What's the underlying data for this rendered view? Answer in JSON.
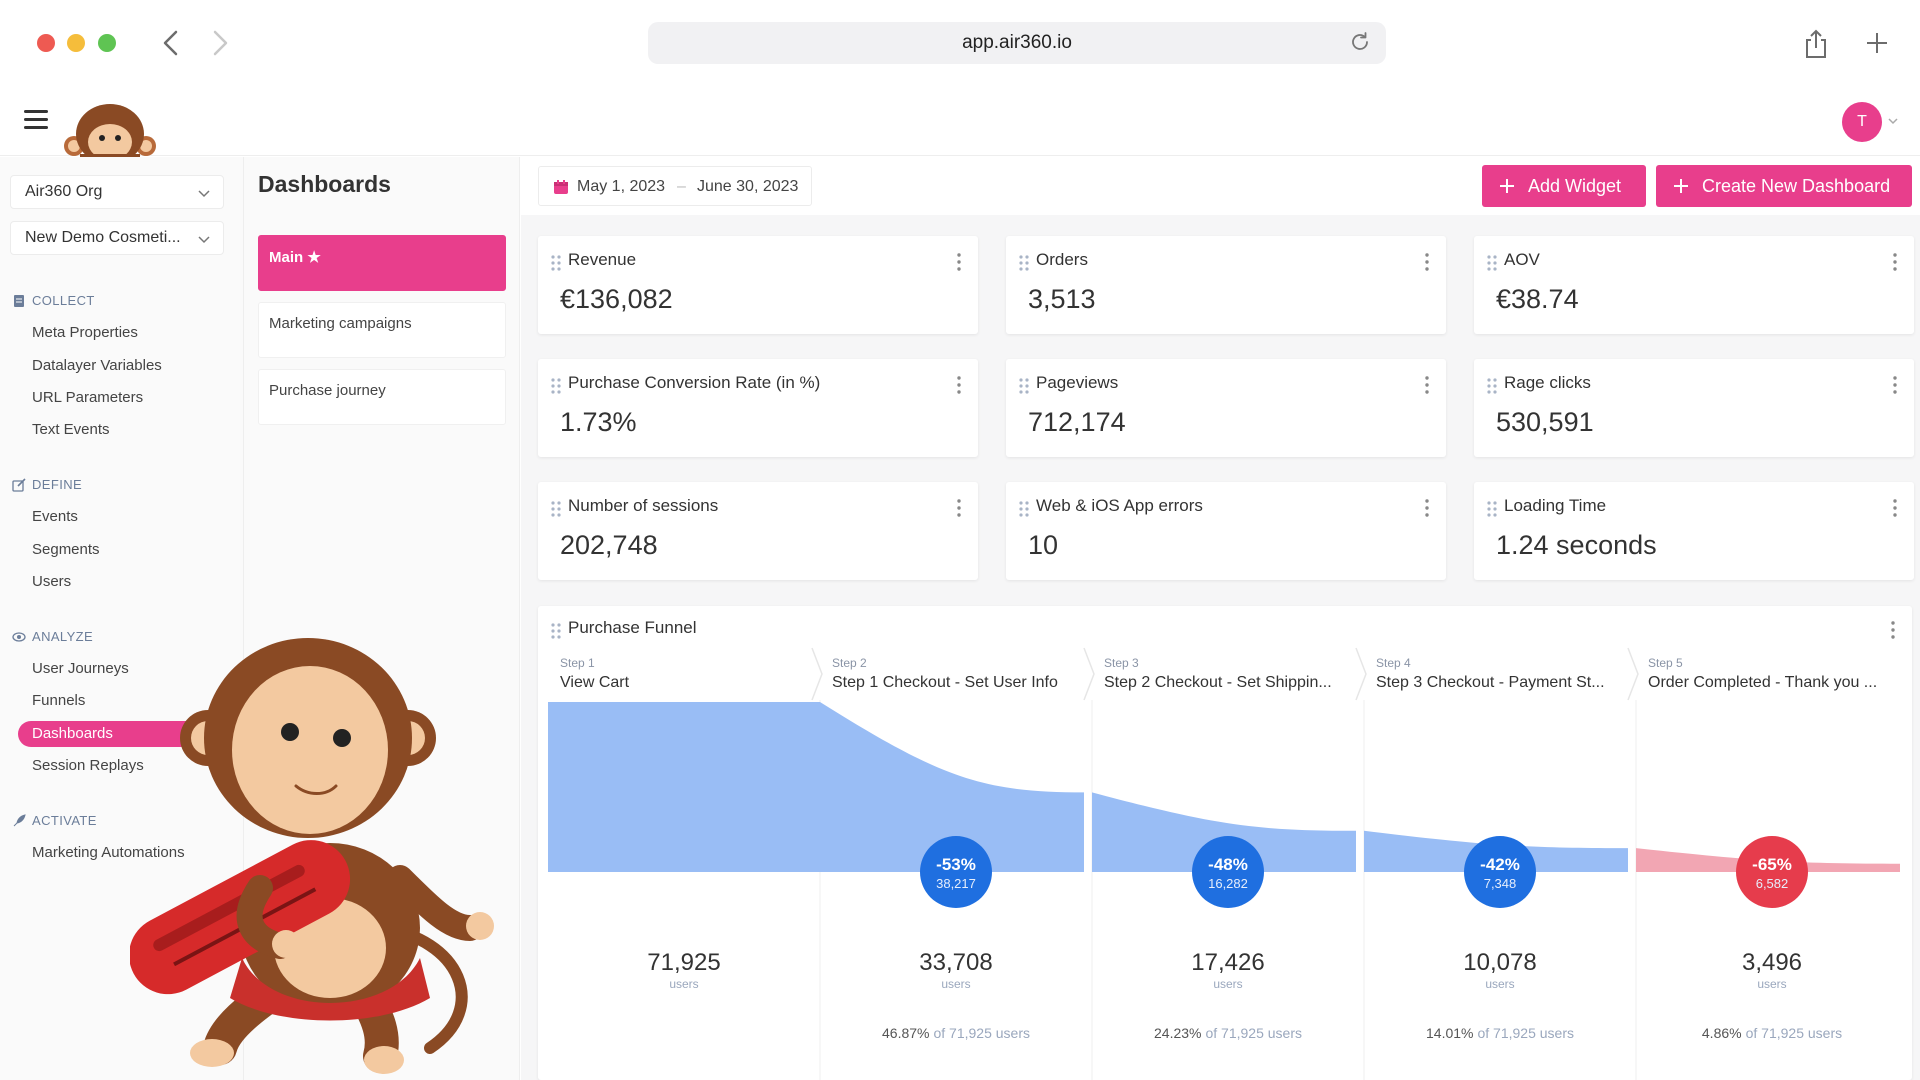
{
  "browser": {
    "url": "app.air360.io"
  },
  "header": {
    "avatar_initial": "T"
  },
  "sidebar": {
    "org_select": "Air360 Org",
    "project_select": "New Demo Cosmeti...",
    "sections": [
      {
        "label": "COLLECT",
        "items": [
          "Meta Properties",
          "Datalayer Variables",
          "URL Parameters",
          "Text Events"
        ]
      },
      {
        "label": "DEFINE",
        "items": [
          "Events",
          "Segments",
          "Users"
        ]
      },
      {
        "label": "ANALYZE",
        "items": [
          "User Journeys",
          "Funnels",
          "Dashboards",
          "Session Replays"
        ]
      },
      {
        "label": "ACTIVATE",
        "items": [
          "Marketing Automations"
        ]
      }
    ],
    "active_item": "Dashboards"
  },
  "dashboards": {
    "title": "Dashboards",
    "items": [
      "Main ★",
      "Marketing campaigns",
      "Purchase journey"
    ],
    "active_index": 0
  },
  "toolbar": {
    "date_start": "May 1, 2023",
    "date_separator": "–",
    "date_end": "June 30, 2023",
    "add_widget": "Add Widget",
    "create_dashboard": "Create New Dashboard"
  },
  "widgets": [
    {
      "title": "Revenue",
      "value": "€136,082"
    },
    {
      "title": "Orders",
      "value": "3,513"
    },
    {
      "title": "AOV",
      "value": "€38.74"
    },
    {
      "title": "Purchase Conversion Rate (in %)",
      "value": "1.73%"
    },
    {
      "title": "Pageviews",
      "value": "712,174"
    },
    {
      "title": "Rage clicks",
      "value": "530,591"
    },
    {
      "title": "Number of sessions",
      "value": "202,748"
    },
    {
      "title": "Web & iOS App errors",
      "value": "10"
    },
    {
      "title": "Loading Time",
      "value": "1.24 seconds"
    }
  ],
  "funnel": {
    "title": "Purchase Funnel",
    "users_label": "users",
    "of_label": "of 71,925 users",
    "colors": {
      "blue": "#99bdf5",
      "pink": "#f2a6b3",
      "badge_blue": "#1f6fe0",
      "badge_red": "#e63c4c"
    }
  },
  "chart_data": {
    "type": "area",
    "title": "Purchase Funnel",
    "categories": [
      "View Cart",
      "Step 1 Checkout - Set User Info",
      "Step 2 Checkout - Set Shippin...",
      "Step 3 Checkout - Payment St...",
      "Order Completed - Thank you ..."
    ],
    "step_labels": [
      "Step 1",
      "Step 2",
      "Step 3",
      "Step 4",
      "Step 5"
    ],
    "values": [
      71925,
      33708,
      17426,
      10078,
      3496
    ],
    "value_labels": [
      "71,925",
      "33,708",
      "17,426",
      "10,078",
      "3,496"
    ],
    "pct_of_first": [
      "",
      "46.87%",
      "24.23%",
      "14.01%",
      "4.86%"
    ],
    "dropoff_pct": [
      "",
      "-53%",
      "-48%",
      "-42%",
      "-65%"
    ],
    "dropoff_count": [
      "",
      "38,217",
      "16,282",
      "7,348",
      "6,582"
    ]
  }
}
